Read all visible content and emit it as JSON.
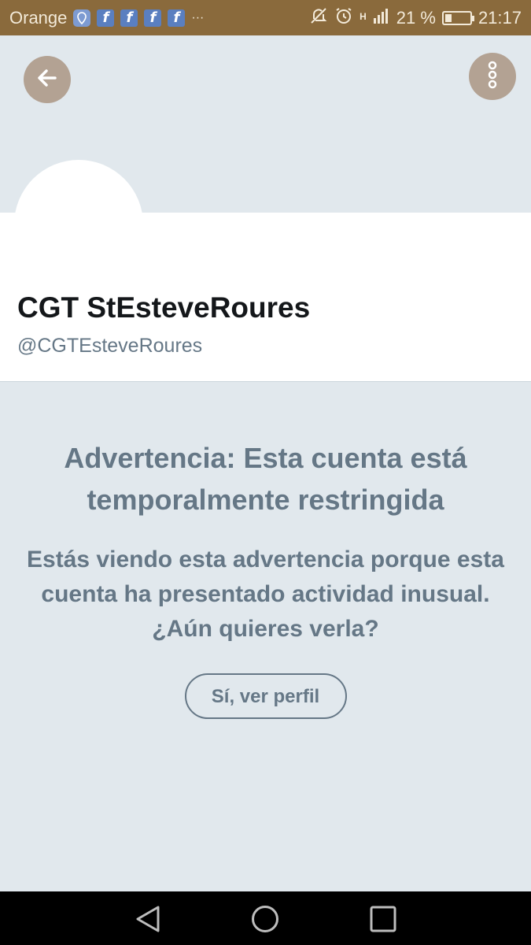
{
  "status_bar": {
    "carrier": "Orange",
    "notification_icons": [
      "location-icon",
      "facebook-icon",
      "facebook-icon",
      "facebook-icon",
      "facebook-icon"
    ],
    "overflow": "···",
    "network": "H",
    "battery_percent": "21 %",
    "time": "21:17"
  },
  "header": {
    "back_icon": "arrow-left-icon",
    "more_icon": "more-vertical-icon"
  },
  "profile": {
    "display_name": "CGT StEsteveRoures",
    "handle": "@CGTEsteveRoures"
  },
  "warning": {
    "title": "Advertencia: Esta cuenta está temporalmente restringida",
    "message": "Estás viendo esta advertencia porque esta cuenta ha presentado actividad inusual. ¿Aún quieres verla?",
    "button_label": "Sí, ver perfil"
  },
  "colors": {
    "status_bar": "#8a6a3c",
    "background": "#e1e8ed",
    "muted_text": "#657786",
    "header_button": "#b3a293"
  }
}
